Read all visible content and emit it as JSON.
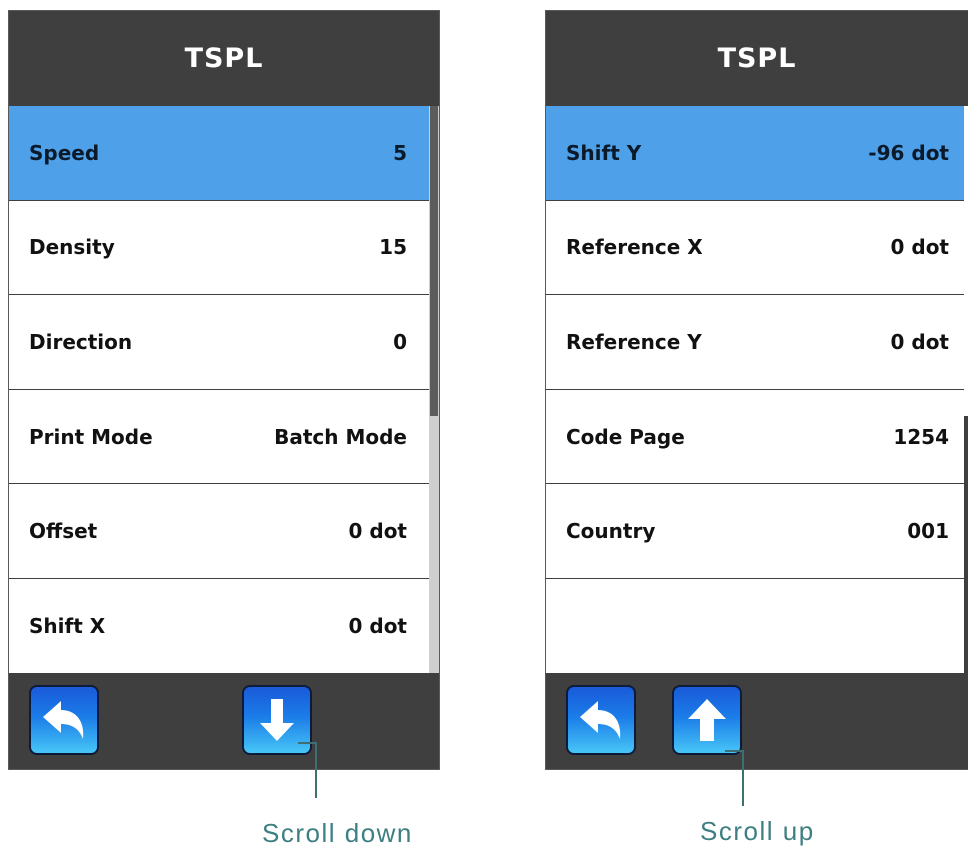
{
  "left_panel": {
    "title": "TSPL",
    "rows": [
      {
        "label": "Speed",
        "value": "5",
        "selected": true
      },
      {
        "label": "Density",
        "value": "15"
      },
      {
        "label": "Direction",
        "value": "0"
      },
      {
        "label": "Print Mode",
        "value": "Batch Mode"
      },
      {
        "label": "Offset",
        "value": "0 dot"
      },
      {
        "label": "Shift X",
        "value": "0 dot"
      }
    ],
    "buttons": {
      "back": "back-arrow-icon",
      "nav": "down-arrow-icon"
    },
    "callout": "Scroll down"
  },
  "right_panel": {
    "title": "TSPL",
    "rows": [
      {
        "label": "Shift Y",
        "value": "-96 dot",
        "selected": true
      },
      {
        "label": "Reference X",
        "value": "0 dot"
      },
      {
        "label": "Reference Y",
        "value": "0 dot"
      },
      {
        "label": "Code Page",
        "value": "1254"
      },
      {
        "label": "Country",
        "value": "001"
      }
    ],
    "buttons": {
      "back": "back-arrow-icon",
      "nav": "up-arrow-icon"
    },
    "callout": "Scroll up"
  },
  "colors": {
    "titlebar": "#3f3f3f",
    "selected_row": "#4ea0e8",
    "callout": "#3e7f82"
  }
}
